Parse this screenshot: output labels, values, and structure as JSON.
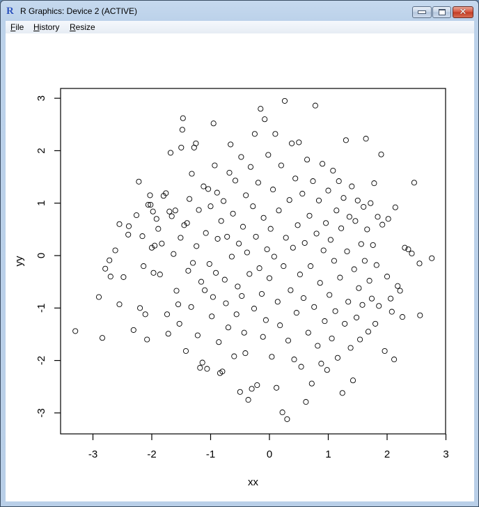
{
  "window": {
    "title": "R Graphics: Device 2 (ACTIVE)",
    "app_icon": "R",
    "controls": {
      "minimize": "minimize-icon",
      "maximize": "maximize-icon",
      "close": "close-icon"
    }
  },
  "menubar": {
    "items": [
      {
        "label": "File",
        "accel": "F"
      },
      {
        "label": "History",
        "accel": "H"
      },
      {
        "label": "Resize",
        "accel": "R"
      }
    ]
  },
  "chart_data": {
    "type": "scatter",
    "title": "",
    "xlabel": "xx",
    "ylabel": "yy",
    "xlim": [
      -3.35,
      3.0
    ],
    "ylim": [
      -3.3,
      3.2
    ],
    "xticks": [
      "-3",
      "-2",
      "-1",
      "0",
      "1",
      "2",
      "3"
    ],
    "yticks": [
      "-3",
      "-2",
      "-1",
      "0",
      "1",
      "2",
      "3"
    ],
    "grid": false,
    "legend": "none",
    "marker": "open-circle",
    "points": [
      [
        -3.3,
        -1.44
      ],
      [
        -2.9,
        -0.79
      ],
      [
        -2.84,
        -1.57
      ],
      [
        -2.79,
        -0.25
      ],
      [
        -2.72,
        -0.09
      ],
      [
        -2.7,
        -0.4
      ],
      [
        -2.62,
        0.1
      ],
      [
        -2.55,
        0.6
      ],
      [
        -2.55,
        -0.93
      ],
      [
        -2.48,
        -0.41
      ],
      [
        -2.4,
        0.4
      ],
      [
        -2.39,
        0.56
      ],
      [
        -2.31,
        -1.42
      ],
      [
        -2.26,
        0.77
      ],
      [
        -2.22,
        1.41
      ],
      [
        -2.2,
        -1.0
      ],
      [
        -2.16,
        0.37
      ],
      [
        -2.14,
        -0.2
      ],
      [
        -2.11,
        -1.12
      ],
      [
        -2.08,
        -1.6
      ],
      [
        -2.06,
        0.97
      ],
      [
        -2.03,
        1.15
      ],
      [
        -2.02,
        0.97
      ],
      [
        -2.0,
        0.15
      ],
      [
        -1.98,
        0.84
      ],
      [
        -1.97,
        -0.33
      ],
      [
        -1.95,
        0.19
      ],
      [
        -1.92,
        0.7
      ],
      [
        -1.89,
        0.51
      ],
      [
        -1.86,
        -0.36
      ],
      [
        -1.83,
        0.23
      ],
      [
        -1.8,
        1.14
      ],
      [
        -1.76,
        1.19
      ],
      [
        -1.74,
        -1.12
      ],
      [
        -1.72,
        -1.49
      ],
      [
        -1.7,
        0.84
      ],
      [
        -1.68,
        1.96
      ],
      [
        -1.66,
        0.75
      ],
      [
        -1.63,
        0.03
      ],
      [
        -1.6,
        0.86
      ],
      [
        -1.58,
        -0.67
      ],
      [
        -1.55,
        -0.93
      ],
      [
        -1.53,
        -1.3
      ],
      [
        -1.51,
        0.34
      ],
      [
        -1.5,
        2.06
      ],
      [
        -1.48,
        2.4
      ],
      [
        -1.47,
        2.62
      ],
      [
        -1.45,
        0.58
      ],
      [
        -1.42,
        -1.82
      ],
      [
        -1.4,
        0.62
      ],
      [
        -1.38,
        -0.29
      ],
      [
        -1.36,
        1.08
      ],
      [
        -1.33,
        -0.98
      ],
      [
        -1.32,
        1.56
      ],
      [
        -1.3,
        -0.14
      ],
      [
        -1.28,
        2.06
      ],
      [
        -1.25,
        2.14
      ],
      [
        -1.24,
        0.18
      ],
      [
        -1.22,
        -1.52
      ],
      [
        -1.2,
        0.87
      ],
      [
        -1.18,
        -2.14
      ],
      [
        -1.16,
        -0.5
      ],
      [
        -1.14,
        -2.04
      ],
      [
        -1.12,
        1.32
      ],
      [
        -1.1,
        -0.66
      ],
      [
        -1.08,
        0.43
      ],
      [
        -1.06,
        -2.16
      ],
      [
        -1.04,
        1.27
      ],
      [
        -1.02,
        -0.16
      ],
      [
        -1.0,
        0.94
      ],
      [
        -0.98,
        -1.16
      ],
      [
        -0.96,
        -0.79
      ],
      [
        -0.95,
        2.52
      ],
      [
        -0.93,
        1.72
      ],
      [
        -0.91,
        -0.33
      ],
      [
        -0.89,
        1.2
      ],
      [
        -0.88,
        0.32
      ],
      [
        -0.86,
        -1.65
      ],
      [
        -0.84,
        -2.24
      ],
      [
        -0.82,
        0.66
      ],
      [
        -0.8,
        -2.21
      ],
      [
        -0.78,
        1.04
      ],
      [
        -0.76,
        -0.46
      ],
      [
        -0.74,
        -0.91
      ],
      [
        -0.72,
        0.36
      ],
      [
        -0.7,
        -1.37
      ],
      [
        -0.68,
        1.58
      ],
      [
        -0.66,
        2.12
      ],
      [
        -0.64,
        -0.02
      ],
      [
        -0.62,
        0.8
      ],
      [
        -0.6,
        -1.92
      ],
      [
        -0.58,
        1.43
      ],
      [
        -0.56,
        -1.12
      ],
      [
        -0.54,
        -0.59
      ],
      [
        -0.52,
        0.23
      ],
      [
        -0.5,
        -2.6
      ],
      [
        -0.48,
        1.88
      ],
      [
        -0.47,
        -0.77
      ],
      [
        -0.45,
        0.55
      ],
      [
        -0.43,
        -1.47
      ],
      [
        -0.41,
        -1.86
      ],
      [
        -0.4,
        1.15
      ],
      [
        -0.38,
        0.06
      ],
      [
        -0.36,
        -2.75
      ],
      [
        -0.34,
        -0.35
      ],
      [
        -0.32,
        1.69
      ],
      [
        -0.3,
        -2.54
      ],
      [
        -0.28,
        0.94
      ],
      [
        -0.26,
        -1.01
      ],
      [
        -0.25,
        2.32
      ],
      [
        -0.23,
        0.36
      ],
      [
        -0.21,
        -2.47
      ],
      [
        -0.19,
        1.39
      ],
      [
        -0.17,
        -0.24
      ],
      [
        -0.15,
        2.8
      ],
      [
        -0.13,
        -0.73
      ],
      [
        -0.11,
        -1.55
      ],
      [
        -0.1,
        0.72
      ],
      [
        -0.08,
        2.6
      ],
      [
        -0.06,
        -1.23
      ],
      [
        -0.04,
        0.12
      ],
      [
        -0.02,
        1.92
      ],
      [
        0.0,
        -0.43
      ],
      [
        0.02,
        0.51
      ],
      [
        0.04,
        -1.93
      ],
      [
        0.06,
        1.26
      ],
      [
        0.08,
        -0.02
      ],
      [
        0.1,
        2.32
      ],
      [
        0.12,
        -2.52
      ],
      [
        0.14,
        -0.88
      ],
      [
        0.16,
        0.86
      ],
      [
        0.18,
        -1.33
      ],
      [
        0.2,
        1.72
      ],
      [
        0.22,
        -2.99
      ],
      [
        0.24,
        -0.2
      ],
      [
        0.26,
        2.95
      ],
      [
        0.28,
        0.34
      ],
      [
        0.3,
        -3.12
      ],
      [
        0.32,
        -1.62
      ],
      [
        0.34,
        1.06
      ],
      [
        0.36,
        -0.66
      ],
      [
        0.38,
        2.14
      ],
      [
        0.4,
        0.15
      ],
      [
        0.42,
        -1.98
      ],
      [
        0.44,
        1.47
      ],
      [
        0.46,
        -1.09
      ],
      [
        0.48,
        0.58
      ],
      [
        0.5,
        2.16
      ],
      [
        0.52,
        -0.36
      ],
      [
        0.54,
        -2.12
      ],
      [
        0.56,
        1.18
      ],
      [
        0.58,
        -0.81
      ],
      [
        0.6,
        0.24
      ],
      [
        0.62,
        -2.79
      ],
      [
        0.64,
        1.83
      ],
      [
        0.66,
        -1.47
      ],
      [
        0.68,
        0.76
      ],
      [
        0.7,
        -0.2
      ],
      [
        0.72,
        -2.44
      ],
      [
        0.74,
        1.42
      ],
      [
        0.76,
        -0.98
      ],
      [
        0.78,
        2.86
      ],
      [
        0.8,
        0.42
      ],
      [
        0.82,
        -1.72
      ],
      [
        0.84,
        1.05
      ],
      [
        0.86,
        -0.52
      ],
      [
        0.88,
        -2.06
      ],
      [
        0.9,
        1.75
      ],
      [
        0.92,
        0.1
      ],
      [
        0.94,
        -1.25
      ],
      [
        0.96,
        0.62
      ],
      [
        0.98,
        -2.18
      ],
      [
        1.0,
        1.24
      ],
      [
        1.02,
        -0.75
      ],
      [
        1.04,
        0.3
      ],
      [
        1.06,
        -1.58
      ],
      [
        1.08,
        1.62
      ],
      [
        1.1,
        -0.1
      ],
      [
        1.12,
        -1.06
      ],
      [
        1.14,
        0.86
      ],
      [
        1.16,
        -1.95
      ],
      [
        1.18,
        1.42
      ],
      [
        1.2,
        -0.42
      ],
      [
        1.22,
        0.52
      ],
      [
        1.24,
        -2.62
      ],
      [
        1.26,
        1.1
      ],
      [
        1.28,
        -1.3
      ],
      [
        1.3,
        2.2
      ],
      [
        1.32,
        0.08
      ],
      [
        1.34,
        -0.88
      ],
      [
        1.36,
        0.74
      ],
      [
        1.38,
        -1.76
      ],
      [
        1.4,
        1.32
      ],
      [
        1.42,
        -2.38
      ],
      [
        1.44,
        -0.26
      ],
      [
        1.46,
        0.66
      ],
      [
        1.48,
        -1.18
      ],
      [
        1.5,
        1.05
      ],
      [
        1.52,
        -0.62
      ],
      [
        1.54,
        -1.6
      ],
      [
        1.56,
        0.22
      ],
      [
        1.58,
        -0.94
      ],
      [
        1.6,
        0.93
      ],
      [
        1.62,
        -0.1
      ],
      [
        1.64,
        2.23
      ],
      [
        1.66,
        0.5
      ],
      [
        1.68,
        -1.45
      ],
      [
        1.7,
        -0.48
      ],
      [
        1.72,
        1.0
      ],
      [
        1.74,
        -0.82
      ],
      [
        1.76,
        0.2
      ],
      [
        1.78,
        1.38
      ],
      [
        1.8,
        -1.3
      ],
      [
        1.82,
        -0.18
      ],
      [
        1.84,
        0.74
      ],
      [
        1.86,
        -0.96
      ],
      [
        1.9,
        1.93
      ],
      [
        1.92,
        0.59
      ],
      [
        1.96,
        -1.82
      ],
      [
        2.0,
        -0.4
      ],
      [
        2.02,
        0.7
      ],
      [
        2.06,
        -0.82
      ],
      [
        2.08,
        -1.07
      ],
      [
        2.12,
        -1.98
      ],
      [
        2.14,
        0.92
      ],
      [
        2.18,
        -0.58
      ],
      [
        2.22,
        -0.67
      ],
      [
        2.26,
        -1.17
      ],
      [
        2.3,
        0.15
      ],
      [
        2.36,
        0.12
      ],
      [
        2.42,
        0.04
      ],
      [
        2.46,
        1.39
      ],
      [
        2.55,
        -0.15
      ],
      [
        2.56,
        -1.14
      ],
      [
        2.76,
        -0.05
      ]
    ]
  }
}
